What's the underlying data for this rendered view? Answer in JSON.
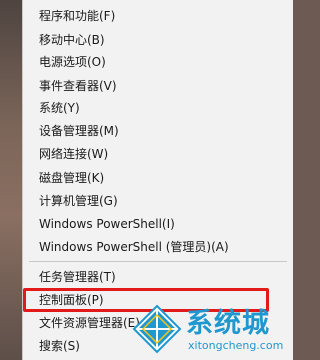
{
  "menu": {
    "items": [
      {
        "label": "程序和功能(F)"
      },
      {
        "label": "移动中心(B)"
      },
      {
        "label": "电源选项(O)"
      },
      {
        "label": "事件查看器(V)"
      },
      {
        "label": "系统(Y)"
      },
      {
        "label": "设备管理器(M)"
      },
      {
        "label": "网络连接(W)"
      },
      {
        "label": "磁盘管理(K)"
      },
      {
        "label": "计算机管理(G)"
      },
      {
        "label": "Windows PowerShell(I)"
      },
      {
        "label": "Windows PowerShell (管理员)(A)"
      },
      {
        "label": "任务管理器(T)"
      },
      {
        "label": "控制面板(P)"
      },
      {
        "label": "文件资源管理器(E)"
      },
      {
        "label": "搜索(S)"
      }
    ],
    "highlighted_item": "控制面板(P)",
    "highlight_color": "#e21a1a"
  },
  "watermark": {
    "title": "系统城",
    "url": "xitongcheng.com",
    "color": "#1f97cf"
  }
}
